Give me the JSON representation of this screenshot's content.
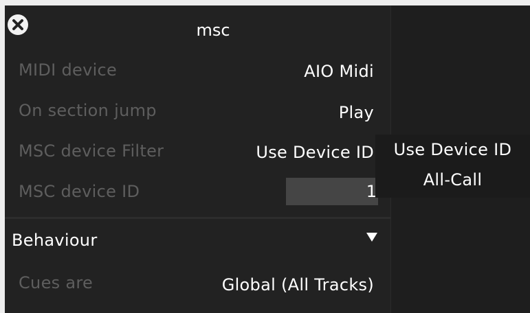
{
  "panel": {
    "title": "msc",
    "rows": [
      {
        "label": "MIDI device",
        "value": "AIO Midi"
      },
      {
        "label": "On section jump",
        "value": "Play"
      },
      {
        "label": "MSC device Filter",
        "value": "Use Device ID"
      },
      {
        "label": "MSC device ID",
        "value": "1"
      }
    ],
    "section": {
      "title": "Behaviour",
      "rows": [
        {
          "label": "Cues are",
          "value": "Global (All Tracks)"
        }
      ]
    }
  },
  "dropdown": {
    "options": [
      "Use Device ID",
      "All-Call"
    ]
  },
  "icons": {
    "close": "close-icon",
    "expand": "triangle-down-icon"
  },
  "colors": {
    "panel_bg": "#222222",
    "label": "#5e5e5e",
    "value": "#ffffff",
    "input_bg": "#454545"
  }
}
